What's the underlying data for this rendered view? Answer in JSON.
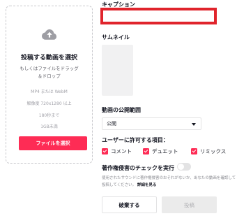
{
  "upload": {
    "title": "投稿する動画を選択",
    "subtitle_line1": "もしくはファイルをドラッグ",
    "subtitle_line2": "＆ドロップ",
    "specs": [
      "MP4 または WebM",
      "解像度 720x1280 以上",
      "180秒まで",
      "1GB未満"
    ],
    "select_button": "ファイルを選択"
  },
  "form": {
    "caption_label": "キャプション",
    "caption_value": "",
    "thumbnail_label": "サムネイル",
    "privacy_label": "動画の公開範囲",
    "privacy_value": "公開",
    "permissions_label": "ユーザーに許可する項目：",
    "permissions": [
      {
        "label": "コメント",
        "checked": true
      },
      {
        "label": "デュエット",
        "checked": true
      },
      {
        "label": "リミックス",
        "checked": true
      }
    ],
    "copyright_label": "著作権侵害のチェックを実行",
    "copyright_enabled": false,
    "note_text": "使用されたサウンドに著作権侵害のおそれがないか、あなたの動画を確認して投稿してください。",
    "note_link": "詳細を見る",
    "discard_button": "破棄する",
    "post_button": "投稿"
  },
  "colors": {
    "accent": "#fe2c55",
    "highlight_border": "#e0242c",
    "disabled_bg": "#ebebeb"
  }
}
